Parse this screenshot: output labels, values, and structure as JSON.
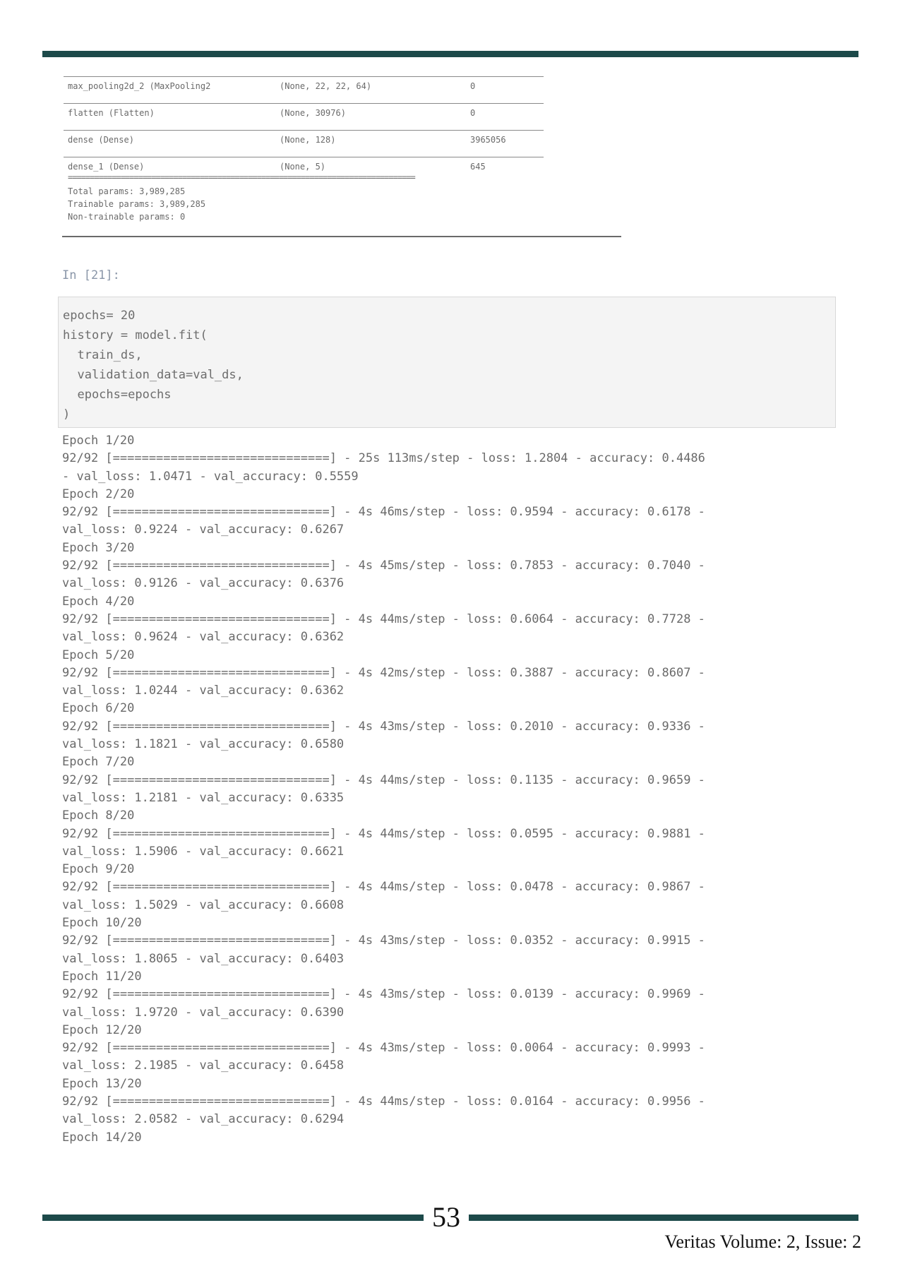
{
  "summary": {
    "rows": [
      {
        "layer": "max_pooling2d_2 (MaxPooling2",
        "shape": "(None, 22, 22, 64)",
        "params": "0"
      },
      {
        "layer": "flatten (Flatten)",
        "shape": "(None, 30976)",
        "params": "0"
      },
      {
        "layer": "dense (Dense)",
        "shape": "(None, 128)",
        "params": "3965056"
      },
      {
        "layer": "dense_1 (Dense)",
        "shape": "(None, 5)",
        "params": "645"
      }
    ],
    "separator": "===============================================================================",
    "total": "Total params: 3,989,285",
    "trainable": "Trainable params: 3,989,285",
    "non_trainable": "Non-trainable params: 0"
  },
  "prompt": "In [21]:",
  "code": [
    "epochs= 20",
    "history = model.fit(",
    "  train_ds,",
    "  validation_data=val_ds,",
    "  epochs=epochs",
    ")"
  ],
  "output": [
    "Epoch 1/20",
    "92/92 [==============================] - 25s 113ms/step - loss: 1.2804 - accuracy: 0.4486",
    "- val_loss: 1.0471 - val_accuracy: 0.5559",
    "Epoch 2/20",
    "92/92 [==============================] - 4s 46ms/step - loss: 0.9594 - accuracy: 0.6178 -",
    "val_loss: 0.9224 - val_accuracy: 0.6267",
    "Epoch 3/20",
    "92/92 [==============================] - 4s 45ms/step - loss: 0.7853 - accuracy: 0.7040 -",
    "val_loss: 0.9126 - val_accuracy: 0.6376",
    "Epoch 4/20",
    "92/92 [==============================] - 4s 44ms/step - loss: 0.6064 - accuracy: 0.7728 -",
    "val_loss: 0.9624 - val_accuracy: 0.6362",
    "Epoch 5/20",
    "92/92 [==============================] - 4s 42ms/step - loss: 0.3887 - accuracy: 0.8607 -",
    "val_loss: 1.0244 - val_accuracy: 0.6362",
    "Epoch 6/20",
    "92/92 [==============================] - 4s 43ms/step - loss: 0.2010 - accuracy: 0.9336 -",
    "val_loss: 1.1821 - val_accuracy: 0.6580",
    "Epoch 7/20",
    "92/92 [==============================] - 4s 44ms/step - loss: 0.1135 - accuracy: 0.9659 -",
    "val_loss: 1.2181 - val_accuracy: 0.6335",
    "Epoch 8/20",
    "92/92 [==============================] - 4s 44ms/step - loss: 0.0595 - accuracy: 0.9881 -",
    "val_loss: 1.5906 - val_accuracy: 0.6621",
    "Epoch 9/20",
    "92/92 [==============================] - 4s 44ms/step - loss: 0.0478 - accuracy: 0.9867 -",
    "val_loss: 1.5029 - val_accuracy: 0.6608",
    "Epoch 10/20",
    "92/92 [==============================] - 4s 43ms/step - loss: 0.0352 - accuracy: 0.9915 -",
    "val_loss: 1.8065 - val_accuracy: 0.6403",
    "Epoch 11/20",
    "92/92 [==============================] - 4s 43ms/step - loss: 0.0139 - accuracy: 0.9969 -",
    "val_loss: 1.9720 - val_accuracy: 0.6390",
    "Epoch 12/20",
    "92/92 [==============================] - 4s 43ms/step - loss: 0.0064 - accuracy: 0.9993 -",
    "val_loss: 2.1985 - val_accuracy: 0.6458",
    "Epoch 13/20",
    "92/92 [==============================] - 4s 44ms/step - loss: 0.0164 - accuracy: 0.9956 -",
    "val_loss: 2.0582 - val_accuracy: 0.6294",
    "Epoch 14/20"
  ],
  "page_number": "53",
  "journal": "Veritas Volume: 2, Issue: 2"
}
